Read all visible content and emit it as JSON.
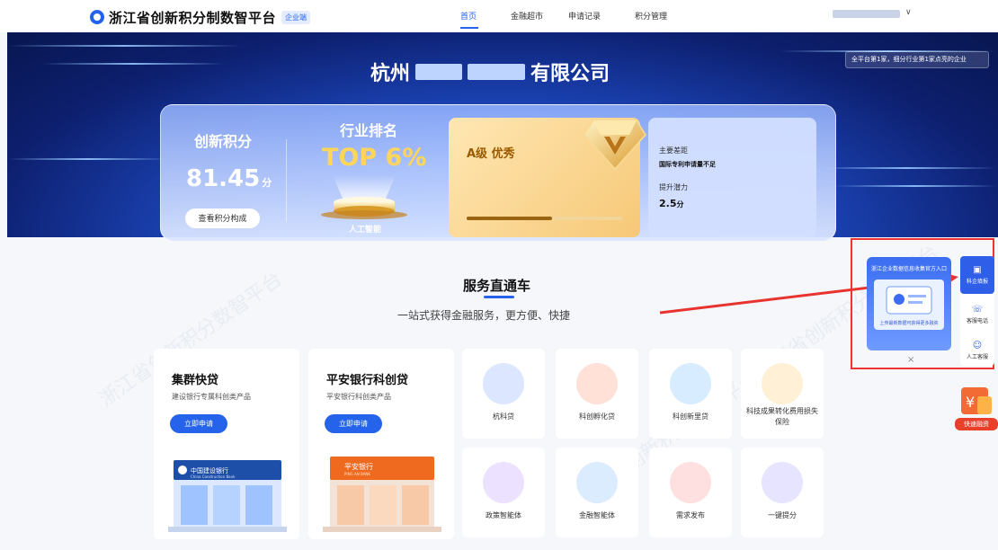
{
  "nav": {
    "logo_text": "浙江省创新积分制数智平台",
    "logo_tag": "企业端",
    "items": [
      "首页",
      "金融超市",
      "申请记录",
      "积分管理"
    ],
    "caret": "∨"
  },
  "hero": {
    "company_prefix": "杭州",
    "company_suffix": "有限公司",
    "rank_badge": "全平台第1家，细分行业第1家点亮的企业",
    "score_label": "创新积分",
    "score_value": "81.45",
    "score_unit": "分",
    "score_button": "查看积分构成",
    "industry_label": "行业排名",
    "industry_value": "TOP 6%",
    "industry_name": "人工智能",
    "grade_label": "A级 优秀",
    "grade_progress": 0.55,
    "gap_title": "主要差距",
    "gap_text": "国际专利申请量不足",
    "potential_title": "提升潜力",
    "potential_value": "2.5",
    "potential_unit": "分"
  },
  "service": {
    "title": "服务直通车",
    "subtitle": "一站式获得金融服务，更方便、快捷",
    "loans": [
      {
        "title": "集群快贷",
        "desc": "建设银行专属科创类产品",
        "button": "立即申请",
        "sign": "中国建设银行",
        "sign_en": "China Construction Bank"
      },
      {
        "title": "平安银行科创贷",
        "desc": "平安银行科创类产品",
        "button": "立即申请",
        "sign": "平安银行",
        "sign_en": "PING AN BANK"
      }
    ],
    "tiles": [
      {
        "label": "杭科贷",
        "icon": "bank-building-icon",
        "color": "#dce6ff"
      },
      {
        "label": "科创孵化贷",
        "icon": "incubator-icon",
        "color": "#ffe1d8"
      },
      {
        "label": "科创新里贷",
        "icon": "dollar-coin-icon",
        "color": "#d8ecff"
      },
      {
        "label": "科技成果转化费用损失保险",
        "icon": "insurance-gift-icon",
        "color": "#fff0d6"
      },
      {
        "label": "政策智能体",
        "icon": "policy-doc-icon",
        "color": "#ece2ff"
      },
      {
        "label": "金融智能体",
        "icon": "finance-ai-icon",
        "color": "#dcecff"
      },
      {
        "label": "需求发布",
        "icon": "demand-publish-icon",
        "color": "#ffe0e0"
      },
      {
        "label": "一键提分",
        "icon": "boost-score-icon",
        "color": "#e6e4ff"
      }
    ]
  },
  "float": {
    "popup_title": "浙江企业数据信息收集官方入口",
    "popup_desc": "上传最新数据可获得更多融资",
    "close": "×",
    "side": [
      {
        "label": "科企填报",
        "icon": "report-icon"
      },
      {
        "label": "客服电话",
        "icon": "phone-icon"
      },
      {
        "label": "人工客服",
        "icon": "agent-icon"
      }
    ],
    "fast_loan": "快速融资"
  },
  "watermark": "浙江省创新积分数智平台"
}
